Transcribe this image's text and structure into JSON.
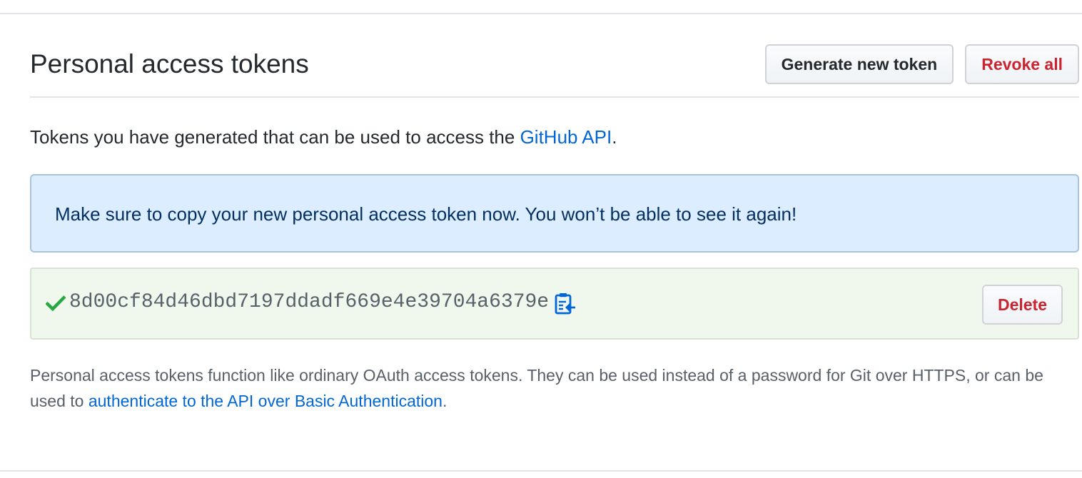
{
  "header": {
    "title": "Personal access tokens",
    "generate_label": "Generate new token",
    "revoke_label": "Revoke all"
  },
  "intro": {
    "text": "Tokens you have generated that can be used to access the ",
    "link_text": "GitHub API",
    "suffix": "."
  },
  "flash": {
    "message": "Make sure to copy your new personal access token now. You won’t be able to see it again!"
  },
  "token": {
    "value": "8d00cf84d46dbd7197ddadf669e4e39704a6379e",
    "status_icon": "check-icon",
    "copy_icon": "clipboard-icon",
    "delete_label": "Delete"
  },
  "note": {
    "text": "Personal access tokens function like ordinary OAuth access tokens. They can be used instead of a password for Git over HTTPS, or can be used to ",
    "link_text": "authenticate to the API over Basic Authentication",
    "suffix": "."
  },
  "colors": {
    "link": "#0366d6",
    "danger": "#cb2431",
    "success": "#28a745",
    "flash_bg": "#dbedff",
    "token_bg": "#f0f8ee"
  }
}
